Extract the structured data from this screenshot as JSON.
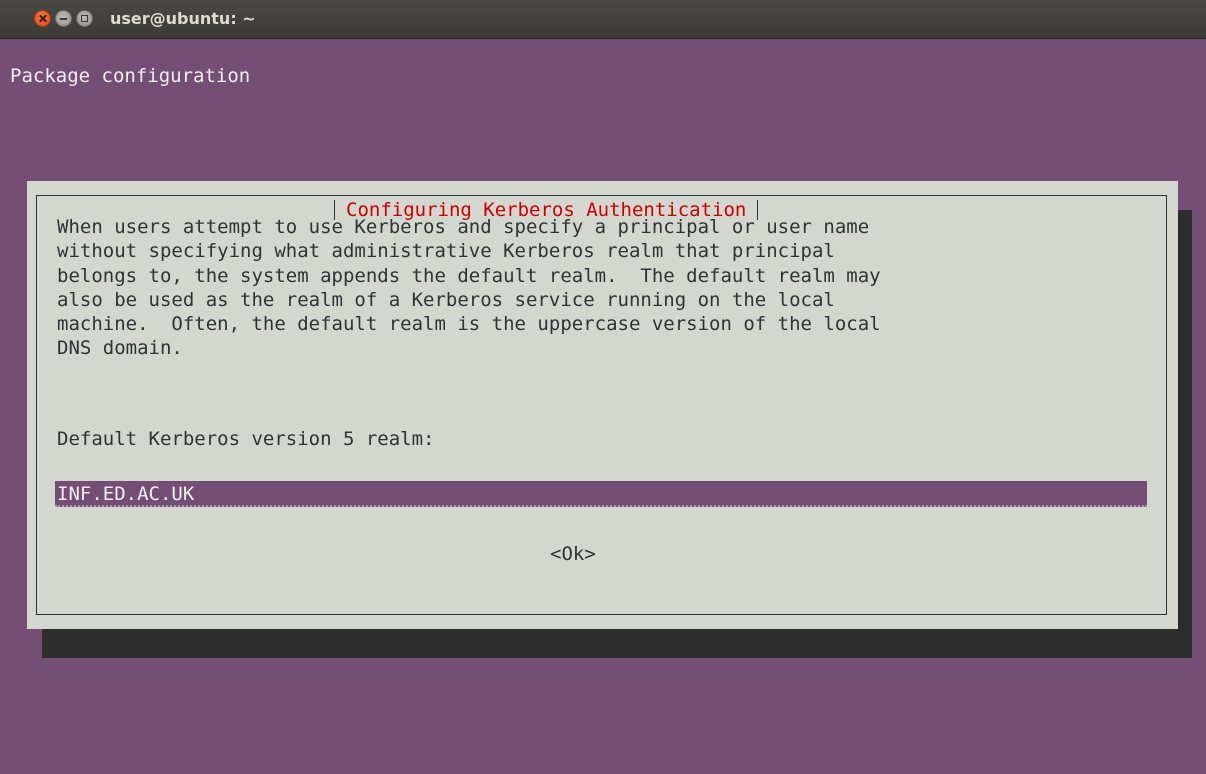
{
  "window": {
    "title": "user@ubuntu: ~"
  },
  "terminal": {
    "header_line": "Package configuration"
  },
  "dialog": {
    "title": "Configuring Kerberos Authentication",
    "description_lines": [
      "When users attempt to use Kerberos and specify a principal or user name",
      "without specifying what administrative Kerberos realm that principal",
      "belongs to, the system appends the default realm.  The default realm may",
      "also be used as the realm of a Kerberos service running on the local",
      "machine.  Often, the default realm is the uppercase version of the local",
      "DNS domain."
    ],
    "prompt_label": "Default Kerberos version 5 realm:",
    "input_value": "INF.ED.AC.UK",
    "ok_label": "<Ok>"
  },
  "colors": {
    "terminal_background": "#754e76",
    "dialog_background": "#d3d7cf",
    "dialog_title": "#cc0000",
    "input_background": "#754e76",
    "shadow": "#2d2d2d"
  },
  "icons": {
    "close": "close-icon",
    "minimize": "minimize-icon",
    "maximize": "maximize-icon"
  }
}
